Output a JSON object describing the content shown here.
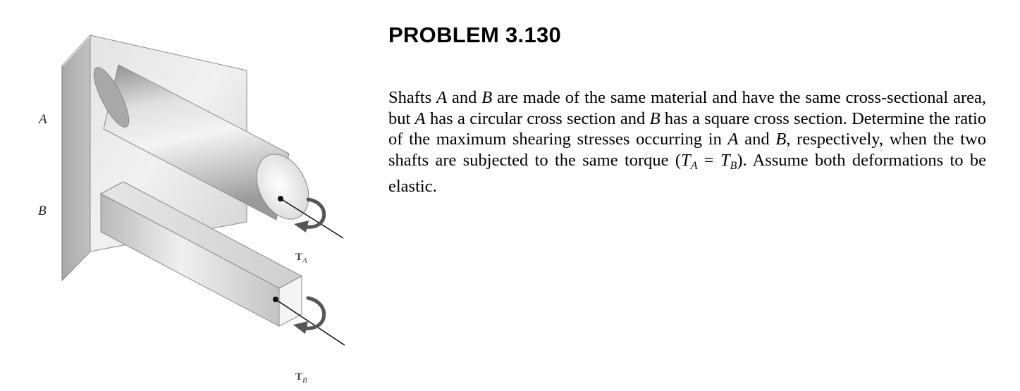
{
  "problem": {
    "title": "PROBLEM 3.130",
    "statement": {
      "p1": "Shafts ",
      "shaft_a": "A",
      "p2": " and ",
      "shaft_b": "B",
      "p3": " are made of the same material and have the same cross-sectional area, but ",
      "shaft_a2": "A",
      "p4": " has a circular cross section and ",
      "shaft_b2": "B",
      "p5": " has a square cross section. Determine the ratio of the maximum shearing stresses occurring in ",
      "shaft_a3": "A",
      "p6": " and ",
      "shaft_b3": "B",
      "p7": ", respectively, when the two shafts are subjected to the same torque (",
      "torque_sym_a": "T",
      "torque_sub_a": "A",
      "eq": " = ",
      "torque_sym_b": "T",
      "torque_sub_b": "B",
      "p8": "). Assume both deformations to be elastic."
    }
  },
  "figure": {
    "label_a": "A",
    "label_b": "B",
    "torque_a_main": "T",
    "torque_a_sub": "A",
    "torque_b_main": "T",
    "torque_b_sub": "B"
  }
}
